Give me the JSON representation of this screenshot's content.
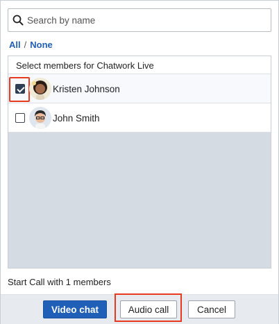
{
  "search": {
    "placeholder": "Search by name",
    "value": "",
    "icon": "search-icon"
  },
  "selection_links": {
    "all": "All",
    "separator": "/",
    "none": "None"
  },
  "panel": {
    "header": "Select members for Chatwork Live",
    "members": [
      {
        "name": "Kristen Johnson",
        "checked": true
      },
      {
        "name": "John Smith",
        "checked": false
      }
    ]
  },
  "status": "Start Call with 1 members",
  "buttons": {
    "video": "Video chat",
    "audio": "Audio call",
    "cancel": "Cancel"
  },
  "colors": {
    "primary": "#1f5fb8",
    "highlight": "#e8391f",
    "panel_bg": "#d5dbe3"
  }
}
